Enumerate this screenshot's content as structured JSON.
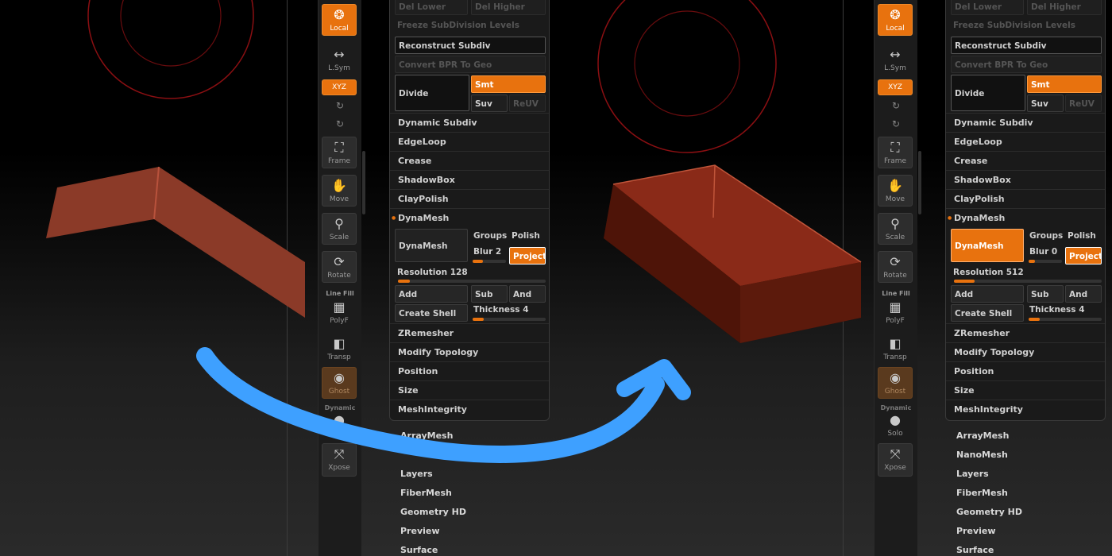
{
  "panels": [
    {
      "id": "left",
      "toolbar": {
        "local": "Local",
        "lsym": "L.Sym",
        "xyz": "XYZ",
        "frame": "Frame",
        "move": "Move",
        "scale": "Scale",
        "rotate": "Rotate",
        "line_fill": "Line Fill",
        "polyf": "PolyF",
        "transp": "Transp",
        "ghost": "Ghost",
        "dynamic": "Dynamic",
        "solo": "Solo",
        "xpose": "Xpose"
      },
      "menu": {
        "del_lower": "Del Lower",
        "del_higher": "Del Higher",
        "freeze_subdiv": "Freeze SubDivision Levels",
        "reconstruct_subdiv": "Reconstruct Subdiv",
        "convert_bpr": "Convert BPR To Geo",
        "divide": "Divide",
        "smt": "Smt",
        "suv": "Suv",
        "reuv": "ReUV",
        "dynamic_subdiv": "Dynamic Subdiv",
        "edgeloop": "EdgeLoop",
        "crease": "Crease",
        "shadowbox": "ShadowBox",
        "claypolish": "ClayPolish",
        "dynamesh_header": "DynaMesh",
        "dynamesh_button": "DynaMesh",
        "groups": "Groups",
        "polish": "Polish",
        "blur": "Blur 2",
        "project": "Project",
        "resolution": "Resolution 128",
        "add": "Add",
        "sub": "Sub",
        "and": "And",
        "create_shell": "Create Shell",
        "thickness": "Thickness 4",
        "zremesher": "ZRemesher",
        "modify_topology": "Modify Topology",
        "position": "Position",
        "size": "Size",
        "meshintegrity": "MeshIntegrity"
      },
      "list": [
        "ArrayMesh",
        "Layers",
        "FiberMesh",
        "Geometry HD",
        "Preview",
        "Surface"
      ]
    },
    {
      "id": "right",
      "toolbar": {
        "local": "Local",
        "lsym": "L.Sym",
        "xyz": "XYZ",
        "frame": "Frame",
        "move": "Move",
        "scale": "Scale",
        "rotate": "Rotate",
        "line_fill": "Line Fill",
        "polyf": "PolyF",
        "transp": "Transp",
        "ghost": "Ghost",
        "dynamic": "Dynamic",
        "solo": "Solo",
        "xpose": "Xpose"
      },
      "menu": {
        "del_lower": "Del Lower",
        "del_higher": "Del Higher",
        "freeze_subdiv": "Freeze SubDivision Levels",
        "reconstruct_subdiv": "Reconstruct Subdiv",
        "convert_bpr": "Convert BPR To Geo",
        "divide": "Divide",
        "smt": "Smt",
        "suv": "Suv",
        "reuv": "ReUV",
        "dynamic_subdiv": "Dynamic Subdiv",
        "edgeloop": "EdgeLoop",
        "crease": "Crease",
        "shadowbox": "ShadowBox",
        "claypolish": "ClayPolish",
        "dynamesh_header": "DynaMesh",
        "dynamesh_button": "DynaMesh",
        "groups": "Groups",
        "polish": "Polish",
        "blur": "Blur 0",
        "project": "Project",
        "resolution": "Resolution 512",
        "add": "Add",
        "sub": "Sub",
        "and": "And",
        "create_shell": "Create Shell",
        "thickness": "Thickness 4",
        "zremesher": "ZRemesher",
        "modify_topology": "Modify Topology",
        "position": "Position",
        "size": "Size",
        "meshintegrity": "MeshIntegrity"
      },
      "list": [
        "ArrayMesh",
        "NanoMesh",
        "Layers",
        "FiberMesh",
        "Geometry HD",
        "Preview",
        "Surface"
      ]
    }
  ],
  "colors": {
    "accent": "#e8720e",
    "mesh": "#8b3a28",
    "arrow": "#3ea0ff",
    "brush_ring": "#8a0f12"
  }
}
